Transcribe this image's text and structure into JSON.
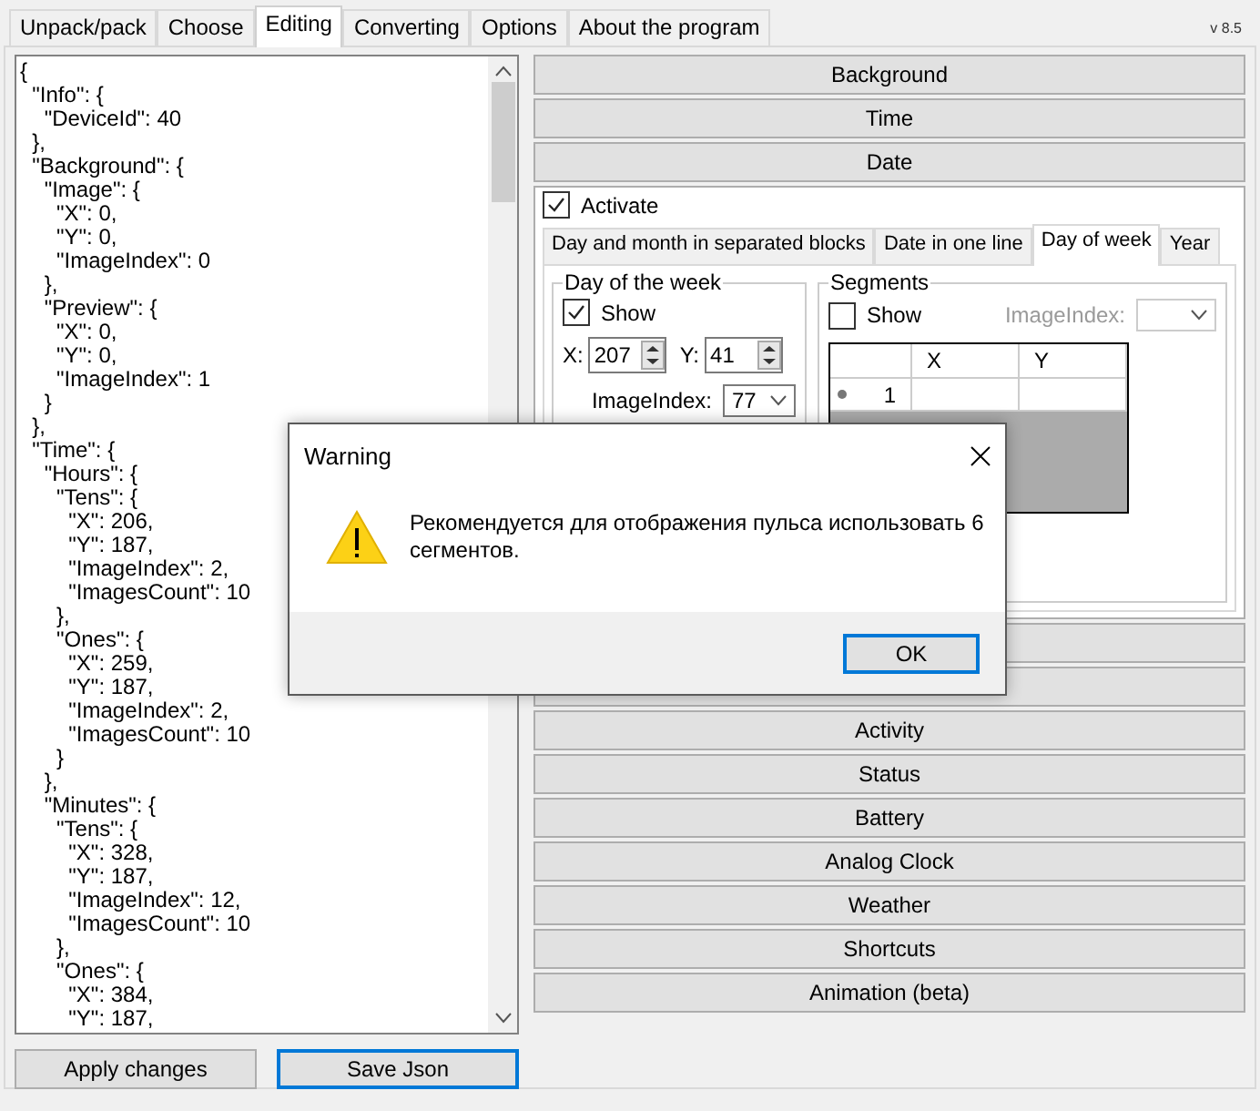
{
  "tabs": [
    {
      "label": "Unpack/pack",
      "selected": false
    },
    {
      "label": "Choose",
      "selected": false
    },
    {
      "label": "Editing",
      "selected": true
    },
    {
      "label": "Converting",
      "selected": false
    },
    {
      "label": "Options",
      "selected": false
    },
    {
      "label": "About the program",
      "selected": false
    }
  ],
  "version": "v 8.5",
  "editor": {
    "lines": [
      "{",
      "  \"Info\": {",
      "    \"DeviceId\": 40",
      "  },",
      "  \"Background\": {",
      "    \"Image\": {",
      "      \"X\": 0,",
      "      \"Y\": 0,",
      "      \"ImageIndex\": 0",
      "    },",
      "    \"Preview\": {",
      "      \"X\": 0,",
      "      \"Y\": 0,",
      "      \"ImageIndex\": 1",
      "    }",
      "  },",
      "  \"Time\": {",
      "    \"Hours\": {",
      "      \"Tens\": {",
      "        \"X\": 206,",
      "        \"Y\": 187,",
      "        \"ImageIndex\": 2,",
      "        \"ImagesCount\": 10",
      "      },",
      "      \"Ones\": {",
      "        \"X\": 259,",
      "        \"Y\": 187,",
      "        \"ImageIndex\": 2,",
      "        \"ImagesCount\": 10",
      "      }",
      "    },",
      "    \"Minutes\": {",
      "      \"Tens\": {",
      "        \"X\": 328,",
      "        \"Y\": 187,",
      "        \"ImageIndex\": 12,",
      "        \"ImagesCount\": 10",
      "      },",
      "      \"Ones\": {",
      "        \"X\": 384,",
      "        \"Y\": 187,"
    ]
  },
  "buttons": [
    {
      "label": "Apply changes",
      "selected": false
    },
    {
      "label": "Save Json",
      "selected": true
    }
  ],
  "sections_top": [
    {
      "label": "Background"
    },
    {
      "label": "Time"
    },
    {
      "label": "Date"
    }
  ],
  "date_panel": {
    "activate": {
      "label": "Activate",
      "checked": true
    },
    "tabs": [
      {
        "label": "Day and month in separated blocks",
        "selected": false
      },
      {
        "label": "Date in one line",
        "selected": false
      },
      {
        "label": "Day of week",
        "selected": true
      },
      {
        "label": "Year",
        "selected": false
      }
    ],
    "day_group": {
      "title": "Day of the week",
      "show": {
        "label": "Show",
        "checked": true
      },
      "x_label": "X:",
      "x_value": "207",
      "y_label": "Y:",
      "y_value": "41",
      "image_index_label": "ImageIndex:",
      "image_index_value": "77"
    },
    "segments_group": {
      "title": "Segments",
      "show": {
        "label": "Show",
        "checked": false
      },
      "image_index_label": "ImageIndex:",
      "columns": [
        "X",
        "Y"
      ],
      "rows": [
        {
          "index": "1"
        }
      ]
    }
  },
  "sections_bottom": [
    {
      "label": "Activity"
    },
    {
      "label": "Status"
    },
    {
      "label": "Battery"
    },
    {
      "label": "Analog Clock"
    },
    {
      "label": "Weather"
    },
    {
      "label": "Shortcuts"
    },
    {
      "label": "Animation (beta)"
    }
  ],
  "dialog": {
    "title": "Warning",
    "message": "Рекомендуется для отображения пульса использовать 6 сегментов.",
    "button": "OK"
  }
}
